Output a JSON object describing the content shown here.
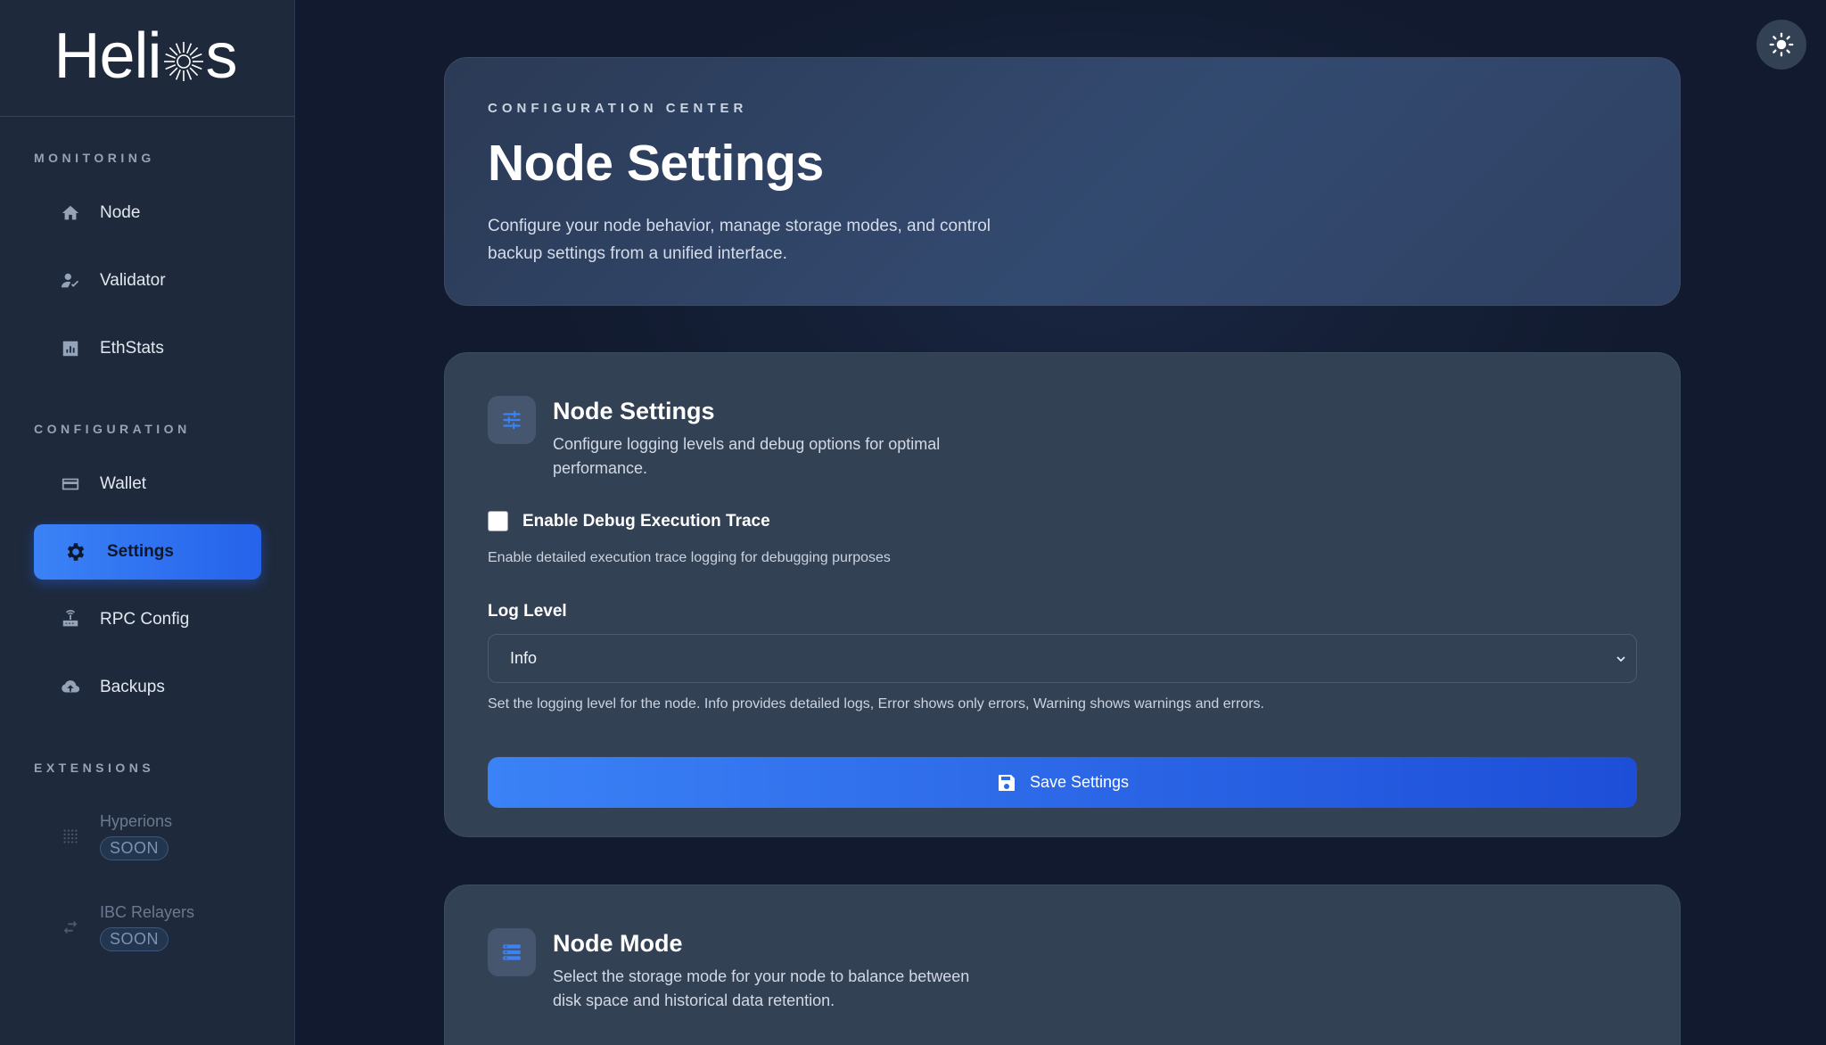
{
  "brand": {
    "name_part1": "Heli",
    "name_part2": "s"
  },
  "sidebar": {
    "sections": [
      {
        "label": "MONITORING"
      },
      {
        "label": "CONFIGURATION"
      },
      {
        "label": "EXTENSIONS"
      }
    ],
    "items": [
      {
        "label": "Node",
        "icon": "home-icon"
      },
      {
        "label": "Validator",
        "icon": "user-check-icon"
      },
      {
        "label": "EthStats",
        "icon": "bar-chart-icon"
      },
      {
        "label": "Wallet",
        "icon": "wallet-icon"
      },
      {
        "label": "Settings",
        "icon": "gear-icon",
        "active": true
      },
      {
        "label": "RPC Config",
        "icon": "router-icon"
      },
      {
        "label": "Backups",
        "icon": "cloud-upload-icon"
      }
    ],
    "extensions": [
      {
        "label": "Hyperions",
        "badge": "SOON",
        "icon": "dots-grid-icon"
      },
      {
        "label": "IBC Relayers",
        "badge": "SOON",
        "icon": "arrows-exchange-icon"
      }
    ]
  },
  "hero": {
    "kicker": "CONFIGURATION CENTER",
    "title": "Node Settings",
    "description": "Configure your node behavior, manage storage modes, and control backup settings from a unified interface."
  },
  "settings_card": {
    "icon": "sliders-icon",
    "title": "Node Settings",
    "description": "Configure logging levels and debug options for optimal performance.",
    "debug_checkbox": {
      "label": "Enable Debug Execution Trace",
      "checked": false
    },
    "debug_help": "Enable detailed execution trace logging for debugging purposes",
    "log_level_label": "Log Level",
    "log_level_value": "Info",
    "log_level_help": "Set the logging level for the node. Info provides detailed logs, Error shows only errors, Warning shows warnings and errors.",
    "save_label": "Save Settings"
  },
  "mode_card": {
    "icon": "list-icon",
    "title": "Node Mode",
    "description": "Select the storage mode for your node to balance between disk space and historical data retention."
  },
  "colors": {
    "accent": "#3b82f6",
    "accent_dark": "#1d4ed8",
    "sidebar_bg": "#1e293b",
    "page_bg": "#111a2e",
    "card_bg": "#334155"
  }
}
